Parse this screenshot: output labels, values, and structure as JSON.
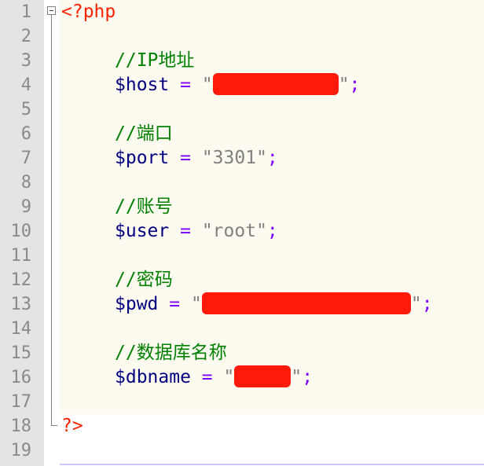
{
  "editor": {
    "line_numbers": [
      "1",
      "2",
      "3",
      "4",
      "5",
      "6",
      "7",
      "8",
      "9",
      "10",
      "11",
      "12",
      "13",
      "14",
      "15",
      "16",
      "17",
      "18",
      "19"
    ],
    "lines": {
      "open_tag": "<?php",
      "comment_ip": "//IP地址",
      "host_var": "$host",
      "port_comment": "//端口",
      "port_var": "$port",
      "port_value": "\"3301\"",
      "user_comment": "//账号",
      "user_var": "$user",
      "user_value": "\"root\"",
      "pwd_comment": "//密码",
      "pwd_var": "$pwd",
      "db_comment": "//数据库名称",
      "db_var": "$dbname",
      "close_tag": "?>"
    },
    "tokens": {
      "eq": "=",
      "quote": "\"",
      "semicolon": ";"
    },
    "colors": {
      "php_tag": "#ff2200",
      "comment": "#008000",
      "variable": "#000080",
      "operator": "#8000ff",
      "string": "#808080",
      "redaction": "#ff1a0a"
    }
  }
}
